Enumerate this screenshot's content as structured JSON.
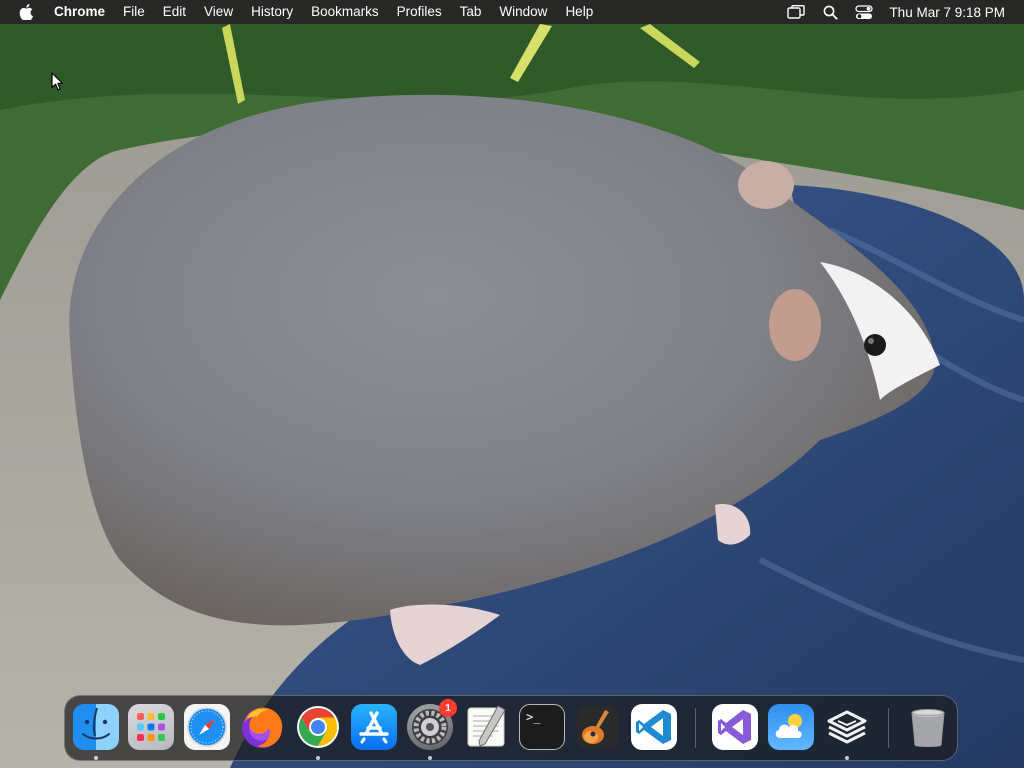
{
  "menubar": {
    "apple_icon": "apple-logo-icon",
    "app_name": "Chrome",
    "menus": [
      "File",
      "Edit",
      "View",
      "History",
      "Bookmarks",
      "Profiles",
      "Tab",
      "Window",
      "Help"
    ],
    "status_icons": [
      "screen-mirroring-icon",
      "spotlight-search-icon",
      "control-center-icon"
    ],
    "clock": "Thu Mar 7  9:18 PM"
  },
  "dock": {
    "apps": [
      {
        "name": "Finder",
        "icon": "finder-icon",
        "running": true
      },
      {
        "name": "Launchpad",
        "icon": "launchpad-icon",
        "running": false
      },
      {
        "name": "Safari",
        "icon": "safari-icon",
        "running": false
      },
      {
        "name": "Firefox",
        "icon": "firefox-icon",
        "running": false
      },
      {
        "name": "Google Chrome",
        "icon": "chrome-icon",
        "running": true
      },
      {
        "name": "App Store",
        "icon": "app-store-icon",
        "running": false
      },
      {
        "name": "System Settings",
        "icon": "system-settings-icon",
        "running": true,
        "badge": "1"
      },
      {
        "name": "TextEdit",
        "icon": "textedit-icon",
        "running": false
      },
      {
        "name": "Terminal",
        "icon": "terminal-icon",
        "running": false
      },
      {
        "name": "GarageBand",
        "icon": "garageband-icon",
        "running": false
      },
      {
        "name": "Visual Studio Code",
        "icon": "vscode-icon",
        "running": false
      },
      {
        "name": "Visual Studio",
        "icon": "visual-studio-icon",
        "running": false
      },
      {
        "name": "Weather",
        "icon": "weather-icon",
        "running": false
      },
      {
        "name": "Layers App",
        "icon": "layers-app-icon",
        "running": true
      },
      {
        "name": "Trash",
        "icon": "trash-icon",
        "running": false
      }
    ],
    "terminal_glyph": ">_"
  },
  "colors": {
    "menubar_bg": "#1e1e1e",
    "badge": "#ff3b30",
    "vscode_blue": "#1f8ad2",
    "chrome_red": "#ea4335",
    "chrome_yellow": "#fbbc05",
    "chrome_green": "#34a853",
    "chrome_blue": "#4285f4"
  }
}
